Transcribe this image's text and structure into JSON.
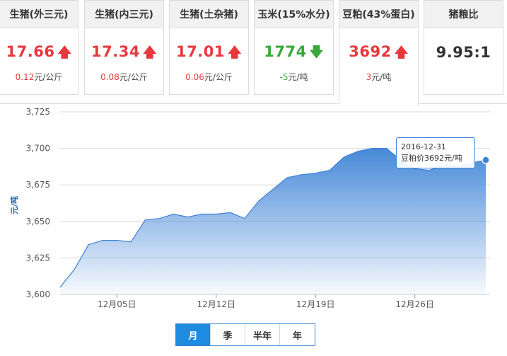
{
  "cards": [
    {
      "title": "生猪(外三元)",
      "price": "17.66",
      "trend": "up",
      "arrow": "🡅",
      "change_num": "0.12",
      "change_unit": "元/公斤"
    },
    {
      "title": "生猪(内三元)",
      "price": "17.34",
      "trend": "up",
      "arrow": "🡅",
      "change_num": "0.08",
      "change_unit": "元/公斤"
    },
    {
      "title": "生猪(土杂猪)",
      "price": "17.01",
      "trend": "up",
      "arrow": "🡅",
      "change_num": "0.06",
      "change_unit": "元/公斤"
    },
    {
      "title": "玉米(15%水分)",
      "price": "1774",
      "trend": "down",
      "arrow": "🡇",
      "change_num": "-5",
      "change_unit": "元/吨"
    },
    {
      "title": "豆粕(43%蛋白)",
      "price": "3692",
      "trend": "up",
      "arrow": "🡅",
      "change_num": "3",
      "change_unit": "元/吨"
    },
    {
      "title": "猪粮比",
      "price": "9.95:1",
      "trend": "none",
      "arrow": "",
      "change_num": "",
      "change_unit": ""
    }
  ],
  "active_card_index": 4,
  "colors": {
    "up": "#e8383d",
    "down": "#3aa83a",
    "series": "#3d82d6",
    "tab_active": "#1e8ae0"
  },
  "tooltip": {
    "date": "2016-12-31",
    "label": "豆粕价3692元/吨"
  },
  "tabs": [
    {
      "label": "月",
      "active": true
    },
    {
      "label": "季",
      "active": false
    },
    {
      "label": "半年",
      "active": false
    },
    {
      "label": "年",
      "active": false
    }
  ],
  "chart_data": {
    "type": "area",
    "title": "",
    "ylabel": "元/吨",
    "xlabel": "",
    "ylim": [
      3600,
      3725
    ],
    "yticks": [
      3600,
      3625,
      3650,
      3675,
      3700,
      3725
    ],
    "ytick_labels": [
      "3,600",
      "3,625",
      "3,650",
      "3,675",
      "3,700",
      "3,725"
    ],
    "grid": true,
    "x": [
      "2016-12-01",
      "2016-12-02",
      "2016-12-03",
      "2016-12-04",
      "2016-12-05",
      "2016-12-06",
      "2016-12-07",
      "2016-12-08",
      "2016-12-09",
      "2016-12-10",
      "2016-12-11",
      "2016-12-12",
      "2016-12-13",
      "2016-12-14",
      "2016-12-15",
      "2016-12-16",
      "2016-12-17",
      "2016-12-18",
      "2016-12-19",
      "2016-12-20",
      "2016-12-21",
      "2016-12-22",
      "2016-12-23",
      "2016-12-24",
      "2016-12-25",
      "2016-12-26",
      "2016-12-27",
      "2016-12-28",
      "2016-12-29",
      "2016-12-30",
      "2016-12-31"
    ],
    "xtick_labels": [
      {
        "x": "2016-12-05",
        "label": "12月05日"
      },
      {
        "x": "2016-12-12",
        "label": "12月12日"
      },
      {
        "x": "2016-12-19",
        "label": "12月19日"
      },
      {
        "x": "2016-12-26",
        "label": "12月26日"
      }
    ],
    "series": [
      {
        "values": [
          3605,
          3617,
          3634,
          3637,
          3637,
          3636,
          3651,
          3652,
          3655,
          3653,
          3655,
          3655,
          3656,
          3652,
          3664,
          3672,
          3680,
          3682,
          3683,
          3685,
          3694,
          3698,
          3700,
          3700,
          3692,
          3686,
          3685,
          3688,
          3688,
          3690,
          3692
        ]
      }
    ],
    "highlight_index": 30
  }
}
